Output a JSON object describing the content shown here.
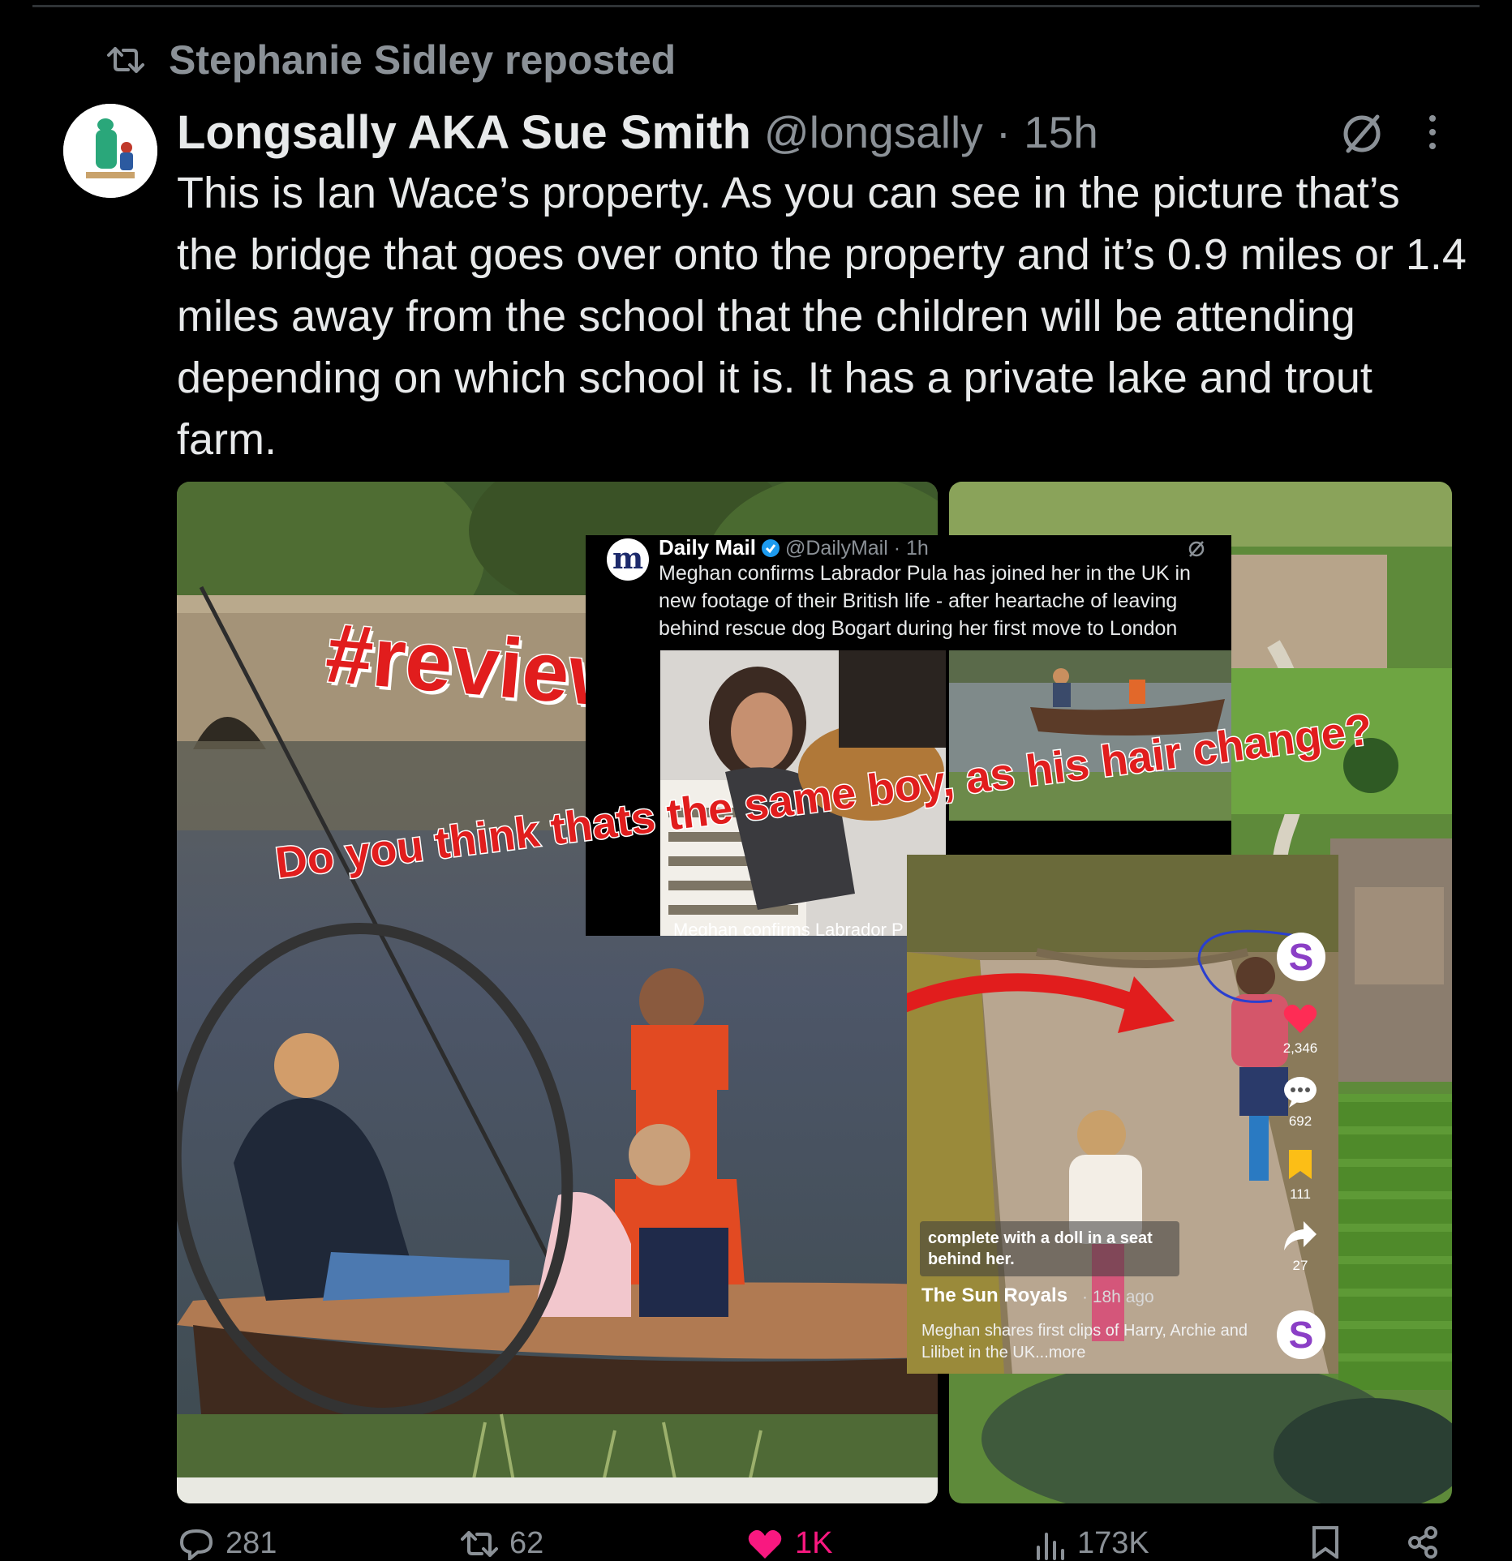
{
  "repost": {
    "icon": "repost-icon",
    "label": "Stephanie Sidley reposted"
  },
  "post": {
    "author_name": "Longsally AKA Sue Smith",
    "handle": "@longsally",
    "separator": "·",
    "time": "15h",
    "text": "This is Ian Wace’s property. As you can see in the picture that’s the bridge that goes over onto the property and it’s 0.9 miles or 1.4 miles away from the school that the children will be attending depending on which school it is. It has a private lake and trout farm."
  },
  "media": {
    "review_tag": "#review",
    "question": "Do you think thats the same boy, as his hair change?",
    "daily_mail": {
      "logo": "m",
      "name": "Daily Mail",
      "handle": "@DailyMail · 1h",
      "text": "Meghan confirms Labrador Pula has joined her in the UK in new footage of their British life - after heartache of leaving behind rescue dog Bogart during her first move to London",
      "caption": "Meghan confirms Labrador P"
    },
    "tiktok": {
      "caption": "complete with a doll in a seat behind her.",
      "account": "The Sun Royals",
      "time": "· 18h ago",
      "description": "Meghan shares first clips of Harry, Archie and Lilibet in the UK...more",
      "likes": "2,346",
      "comments": "692",
      "saves": "111",
      "shares": "27",
      "avatar_letter": "S"
    }
  },
  "actions": {
    "replies": "281",
    "reposts": "62",
    "likes": "1K",
    "views": "173K"
  },
  "colors": {
    "background": "#000000",
    "muted": "#8b9197",
    "like": "#f91880",
    "overlay_red": "#e11d1d"
  }
}
